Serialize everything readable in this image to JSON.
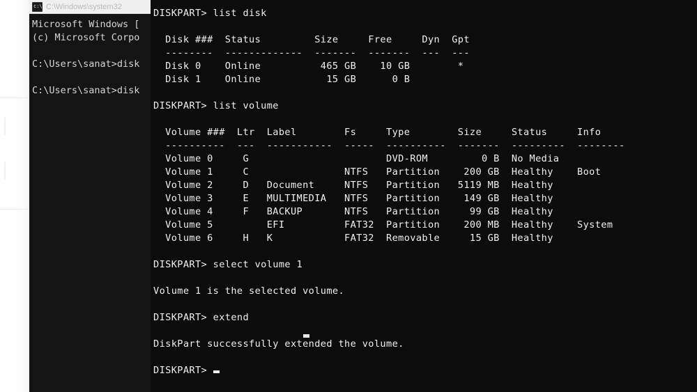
{
  "background_console": {
    "title": "C:\\Windows\\system32",
    "icon": "console-icon",
    "lines": [
      "Microsoft Windows [",
      "(c) Microsoft Corpo",
      "",
      "C:\\Users\\sanat>disk",
      "",
      "C:\\Users\\sanat>disk"
    ]
  },
  "diskpart": {
    "prompt": "DISKPART>",
    "cursor": "_",
    "commands": {
      "list_disk": "list disk",
      "list_volume": "list volume",
      "select_volume": "select volume 1",
      "extend": "extend"
    },
    "messages": {
      "selected_volume": "Volume 1 is the selected volume.",
      "extend_success": "DiskPart successfully extended the volume."
    },
    "disk_table": {
      "headers": [
        "Disk ###",
        "Status",
        "Size",
        "Free",
        "Dyn",
        "Gpt"
      ],
      "separators": [
        "--------",
        "-------------",
        "-------",
        "-------",
        "---",
        "---"
      ],
      "rows": [
        {
          "disk": "Disk 0",
          "status": "Online",
          "size": "465 GB",
          "free": "10 GB",
          "dyn": "",
          "gpt": "*"
        },
        {
          "disk": "Disk 1",
          "status": "Online",
          "size": "15 GB",
          "free": "0 B",
          "dyn": "",
          "gpt": ""
        }
      ]
    },
    "volume_table": {
      "headers": [
        "Volume ###",
        "Ltr",
        "Label",
        "Fs",
        "Type",
        "Size",
        "Status",
        "Info"
      ],
      "separators": [
        "----------",
        "---",
        "-----------",
        "-----",
        "----------",
        "-------",
        "---------",
        "--------"
      ],
      "rows": [
        {
          "volume": "Volume 0",
          "ltr": "G",
          "label": "",
          "fs": "",
          "type": "DVD-ROM",
          "size": "0 B",
          "status": "No Media",
          "info": ""
        },
        {
          "volume": "Volume 1",
          "ltr": "C",
          "label": "",
          "fs": "NTFS",
          "type": "Partition",
          "size": "200 GB",
          "status": "Healthy",
          "info": "Boot"
        },
        {
          "volume": "Volume 2",
          "ltr": "D",
          "label": "Document",
          "fs": "NTFS",
          "type": "Partition",
          "size": "5119 MB",
          "status": "Healthy",
          "info": ""
        },
        {
          "volume": "Volume 3",
          "ltr": "E",
          "label": "MULTIMEDIA",
          "fs": "NTFS",
          "type": "Partition",
          "size": "149 GB",
          "status": "Healthy",
          "info": ""
        },
        {
          "volume": "Volume 4",
          "ltr": "F",
          "label": "BACKUP",
          "fs": "NTFS",
          "type": "Partition",
          "size": "99 GB",
          "status": "Healthy",
          "info": ""
        },
        {
          "volume": "Volume 5",
          "ltr": "",
          "label": "EFI",
          "fs": "FAT32",
          "type": "Partition",
          "size": "200 MB",
          "status": "Healthy",
          "info": "System"
        },
        {
          "volume": "Volume 6",
          "ltr": "H",
          "label": "K",
          "fs": "FAT32",
          "type": "Removable",
          "size": "15 GB",
          "status": "Healthy",
          "info": ""
        }
      ]
    },
    "screen_text": "DISKPART> list disk\n\n  Disk ###  Status         Size     Free     Dyn  Gpt\n  --------  -------------  -------  -------  ---  ---\n  Disk 0    Online          465 GB    10 GB        *\n  Disk 1    Online           15 GB      0 B\n\nDISKPART> list volume\n\n  Volume ###  Ltr  Label        Fs     Type        Size     Status     Info\n  ----------  ---  -----------  -----  ----------  -------  ---------  --------\n  Volume 0     G                       DVD-ROM         0 B  No Media\n  Volume 1     C                NTFS   Partition    200 GB  Healthy    Boot\n  Volume 2     D   Document     NTFS   Partition   5119 MB  Healthy\n  Volume 3     E   MULTIMEDIA   NTFS   Partition    149 GB  Healthy\n  Volume 4     F   BACKUP       NTFS   Partition     99 GB  Healthy\n  Volume 5         EFI          FAT32  Partition    200 MB  Healthy    System\n  Volume 6     H   K            FAT32  Removable     15 GB  Healthy\n\nDISKPART> select volume 1\n\nVolume 1 is the selected volume.\n\nDISKPART> extend\n\nDiskPart successfully extended the volume.\n\nDISKPART> "
  }
}
